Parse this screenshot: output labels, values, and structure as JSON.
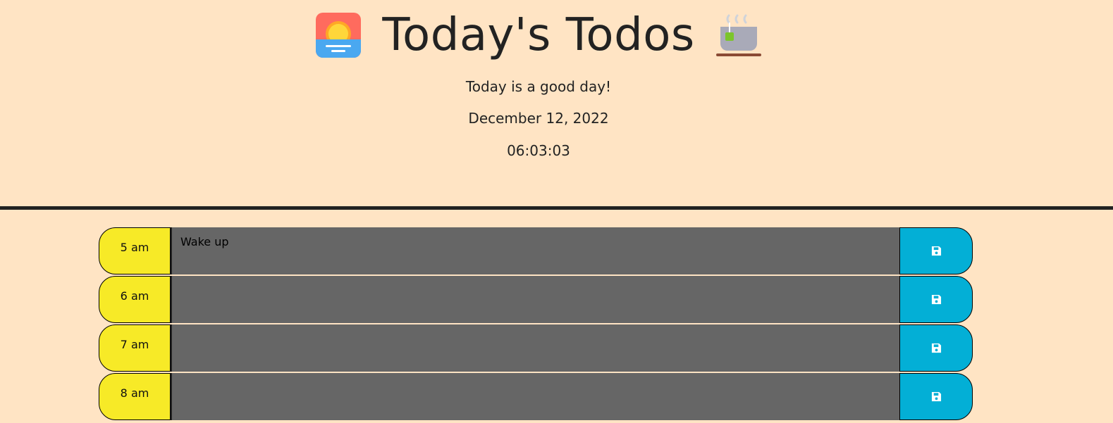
{
  "header": {
    "title": "Today's Todos",
    "tagline": "Today is a good day!",
    "date": "December 12, 2022",
    "time": "06:03:03",
    "left_icon": "sunrise-icon",
    "right_icon": "tea-cup-icon"
  },
  "schedule": {
    "rows": [
      {
        "hour": "5 am",
        "task": "Wake up"
      },
      {
        "hour": "6 am",
        "task": ""
      },
      {
        "hour": "7 am",
        "task": ""
      },
      {
        "hour": "8 am",
        "task": ""
      }
    ],
    "save_icon": "floppy-disk-icon"
  },
  "colors": {
    "background": "#ffe4c4",
    "hour_block": "#f7ea27",
    "task_area": "#666666",
    "save_button": "#03afd6",
    "divider": "#222222"
  }
}
